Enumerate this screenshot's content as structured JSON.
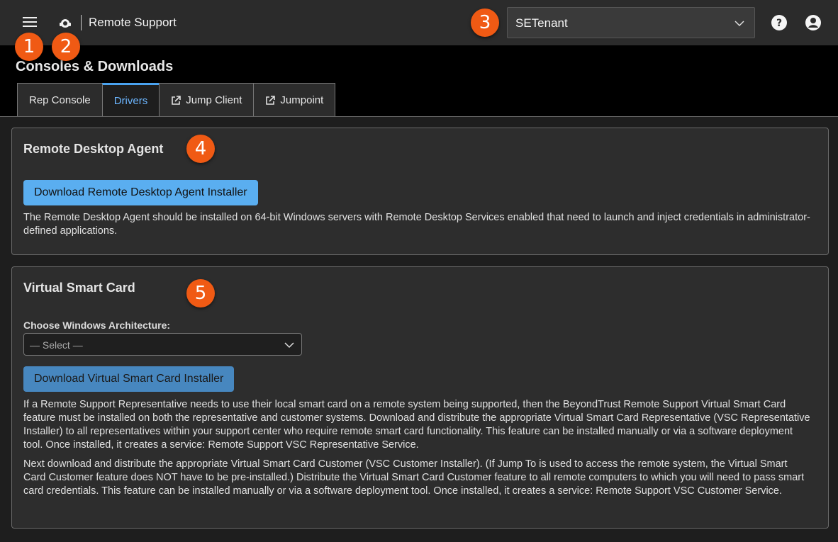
{
  "topbar": {
    "app_title": "Remote Support",
    "tenant_value": "SETenant",
    "icons": [
      "menu-icon",
      "headset-logo-icon",
      "chevron-down-icon",
      "help-icon",
      "user-icon"
    ]
  },
  "markers": [
    "1",
    "2",
    "3",
    "4",
    "5"
  ],
  "page": {
    "title": "Consoles & Downloads",
    "tabs": [
      {
        "label": "Rep Console",
        "active": false,
        "external": false
      },
      {
        "label": "Drivers",
        "active": true,
        "external": false
      },
      {
        "label": "Jump Client",
        "active": false,
        "external": true
      },
      {
        "label": "Jumpoint",
        "active": false,
        "external": true
      }
    ]
  },
  "rda": {
    "title": "Remote Desktop Agent",
    "button": "Download Remote Desktop Agent Installer",
    "description": "The Remote Desktop Agent should be installed on 64-bit Windows servers with Remote Desktop Services enabled that need to launch and inject credentials in administrator-defined applications."
  },
  "vsc": {
    "title": "Virtual Smart Card",
    "arch_label": "Choose Windows Architecture:",
    "arch_value": "— Select —",
    "button": "Download Virtual Smart Card Installer",
    "para1": "If a Remote Support Representative needs to use their local smart card on a remote system being supported, then the BeyondTrust Remote Support Virtual Smart Card feature must be installed on both the representative and customer systems. Download and distribute the appropriate Virtual Smart Card Representative (VSC Representative Installer) to all representatives within your support center who require remote smart card functionality. This feature can be installed manually or via a software deployment tool. Once installed, it creates a service: Remote Support VSC Representative Service.",
    "para2": "Next download and distribute the appropriate Virtual Smart Card Customer (VSC Customer Installer). (If Jump To is used to access the remote system, the Virtual Smart Card Customer feature does NOT have to be pre-installed.) Distribute the Virtual Smart Card Customer feature to all remote computers to which you will need to pass smart card credentials. This feature can be installed manually or via a software deployment tool. Once installed, it creates a service: Remote Support VSC Customer Service."
  },
  "colors": {
    "accent": "#5aaef0",
    "marker": "#f05a14",
    "topbar": "#2b2b2b",
    "panel": "#2d2d2d"
  }
}
